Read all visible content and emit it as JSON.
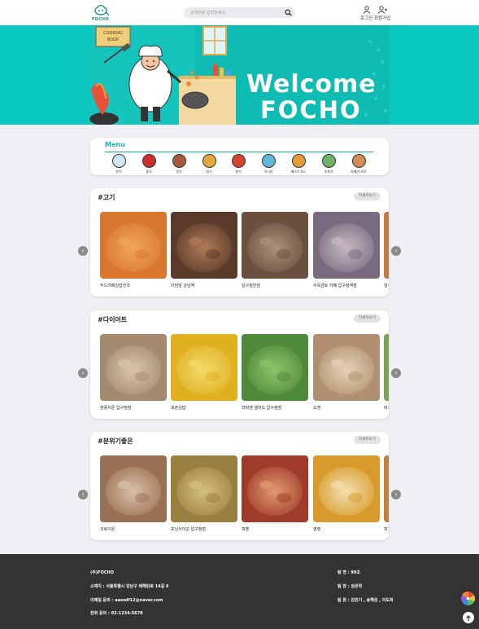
{
  "header": {
    "logo_text": "FOCHO",
    "search_placeholder": "검색어를 입력하세요",
    "login_label": "로그인",
    "signup_label": "회원가입"
  },
  "banner": {
    "line1": "Welcome",
    "line2": "FOCHO"
  },
  "menu": {
    "title": "Menu",
    "categories": [
      {
        "label": "한식",
        "icon": "rice-bowl-icon",
        "color": "#cfe7f5"
      },
      {
        "label": "중식",
        "icon": "dumpling-icon",
        "color": "#c9302c"
      },
      {
        "label": "양식",
        "icon": "steak-icon",
        "color": "#a55a3a"
      },
      {
        "label": "일식",
        "icon": "ramen-icon",
        "color": "#e3aa3a"
      },
      {
        "label": "분식",
        "icon": "tteokbokki-icon",
        "color": "#d2442b"
      },
      {
        "label": "아시안",
        "icon": "noodle-icon",
        "color": "#62b5d6"
      },
      {
        "label": "패스트푸드",
        "icon": "burger-icon",
        "color": "#e89a3a"
      },
      {
        "label": "조제식",
        "icon": "lunchbox-icon",
        "color": "#6bb36a"
      },
      {
        "label": "카페/디저트",
        "icon": "cake-icon",
        "color": "#d48c55"
      }
    ]
  },
  "sections": [
    {
      "title": "#고기",
      "more_label": "자세히보기",
      "items": [
        {
          "name": "두드려패김밥천국",
          "c1": "#d9772f",
          "c2": "#f0a55a"
        },
        {
          "name": "더담담 강남역",
          "c1": "#5a3a2a",
          "c2": "#b07a55"
        },
        {
          "name": "달구벌반점",
          "c1": "#6b5040",
          "c2": "#a9927a"
        },
        {
          "name": "수목금토 카페 압구정역점",
          "c1": "#7a6a80",
          "c2": "#c7b9c0"
        },
        {
          "name": "일식",
          "c1": "#c47a40",
          "c2": "#e0b080"
        }
      ]
    },
    {
      "title": "#다이어트",
      "more_label": "자세히보기",
      "items": [
        {
          "name": "현풍지존 압구정점",
          "c1": "#a58a70",
          "c2": "#d9c6a8"
        },
        {
          "name": "북촌김밥",
          "c1": "#e0b020",
          "c2": "#f3da6a"
        },
        {
          "name": "라바앤 샐러드 압구정점",
          "c1": "#4f8a3a",
          "c2": "#8fc36a"
        },
        {
          "name": "오엔",
          "c1": "#b09070",
          "c2": "#e6d2b8"
        },
        {
          "name": "버거",
          "c1": "#7aa050",
          "c2": "#c8d8a0"
        }
      ]
    },
    {
      "title": "#분위기좋은",
      "more_label": "자세히보기",
      "items": [
        {
          "name": "코로이온",
          "c1": "#9a7055",
          "c2": "#d8c0a8"
        },
        {
          "name": "포닝사이곤 압구정점",
          "c1": "#9a8040",
          "c2": "#d4c080"
        },
        {
          "name": "피맨",
          "c1": "#a03a2a",
          "c2": "#e09a70"
        },
        {
          "name": "영영",
          "c1": "#d89a2a",
          "c2": "#f3e0b0"
        },
        {
          "name": "피그",
          "c1": "#c08040",
          "c2": "#e8c090"
        }
      ]
    }
  ],
  "footer": {
    "company": "(주)FOCHO",
    "address": "소재지 : 서울특별시 강남구 테헤란로 14길 6",
    "email": "이메일 문의 : aassdf12@naver.com",
    "phone": "전화 문의 : 02-1234-5678",
    "team_name": "팀 명 : 99조",
    "team_leader": "팀 장 : 성은학",
    "team_members": "팀 원 : 김민기 , 송해성 , 이도희"
  }
}
